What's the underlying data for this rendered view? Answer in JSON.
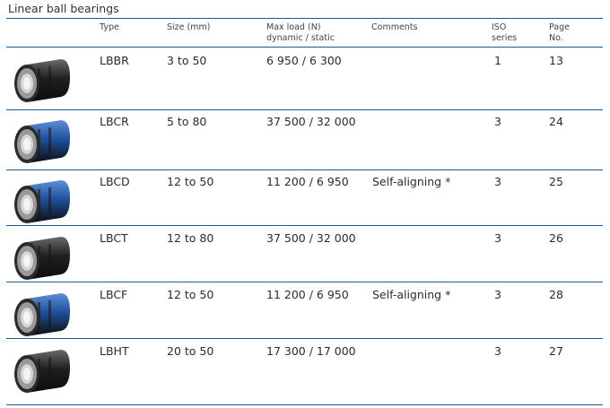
{
  "title": "Linear ball bearings",
  "headers": {
    "type": "Type",
    "size": "Size (mm)",
    "maxload_1": "Max load (N)",
    "maxload_2": "dynamic / static",
    "comments": "Comments",
    "iso_1": "ISO",
    "iso_2": "series",
    "page_1": "Page",
    "page_2": "No."
  },
  "rows": [
    {
      "type": "LBBR",
      "size": "3 to 50",
      "load": "6 950 / 6 300",
      "comment": "",
      "iso": "1",
      "page": "13",
      "color": "black"
    },
    {
      "type": "LBCR",
      "size": "5 to 80",
      "load": "37 500 / 32 000",
      "comment": "",
      "iso": "3",
      "page": "24",
      "color": "blue"
    },
    {
      "type": "LBCD",
      "size": "12 to 50",
      "load": "11 200 / 6 950",
      "comment": "Self-aligning *",
      "iso": "3",
      "page": "25",
      "color": "blue"
    },
    {
      "type": "LBCT",
      "size": "12 to 80",
      "load": "37 500 / 32 000",
      "comment": "",
      "iso": "3",
      "page": "26",
      "color": "black"
    },
    {
      "type": "LBCF",
      "size": "12 to 50",
      "load": "11 200 / 6 950",
      "comment": "Self-aligning *",
      "iso": "3",
      "page": "28",
      "color": "blue"
    },
    {
      "type": "LBHT",
      "size": "20 to 50",
      "load": "17 300 / 17 000",
      "comment": "",
      "iso": "3",
      "page": "27",
      "color": "black"
    }
  ],
  "colors": {
    "rule": "#1a5a96",
    "body_black": "#1f1f1f",
    "body_blue": "#1e4f9c"
  }
}
